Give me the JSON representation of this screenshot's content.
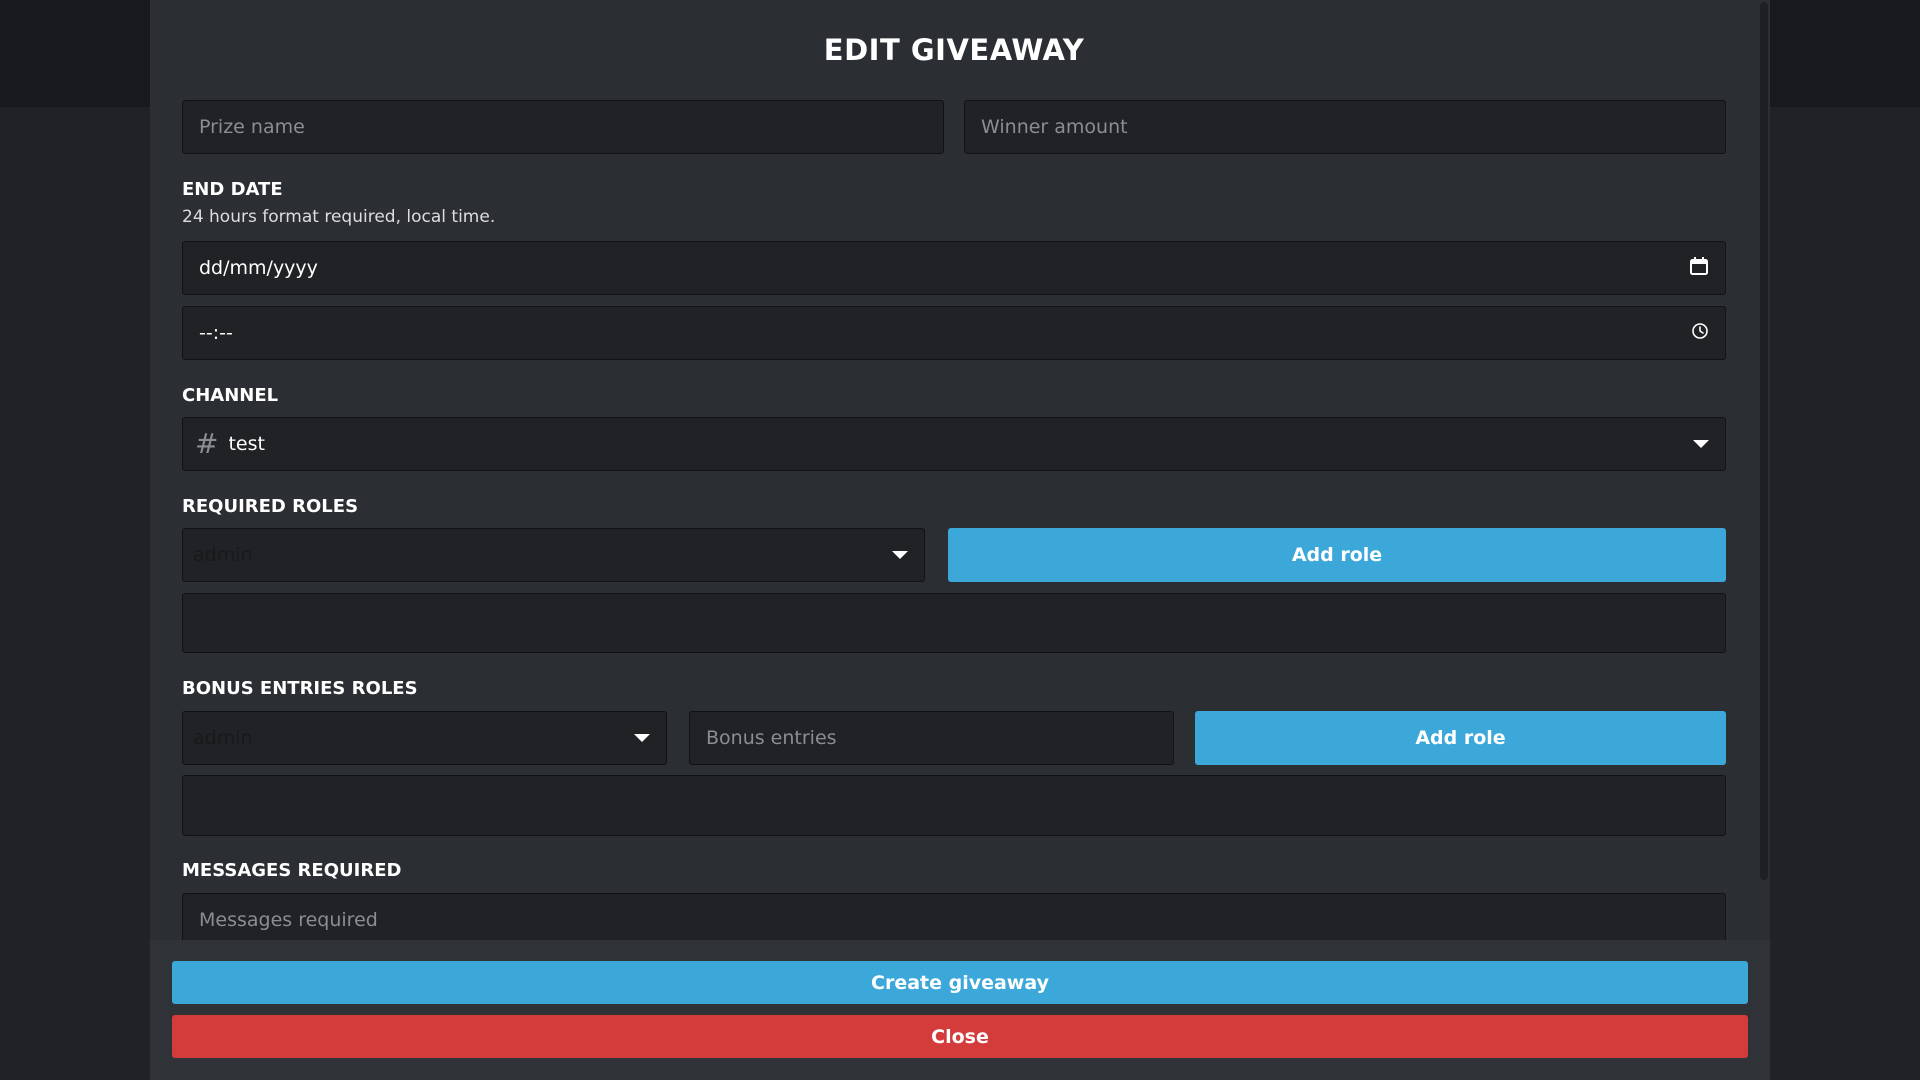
{
  "modal": {
    "title": "EDIT GIVEAWAY"
  },
  "prize": {
    "placeholder": "Prize name"
  },
  "winners": {
    "placeholder": "Winner amount"
  },
  "end_date": {
    "label": "END DATE",
    "hint": "24 hours format required, local time.",
    "date_value": "dd/mm/yyyy",
    "time_value": "--:--",
    "date_icon": "calendar-icon",
    "time_icon": "clock-icon"
  },
  "channel": {
    "label": "CHANNEL",
    "prefix": "#",
    "value": "test"
  },
  "required_roles": {
    "label": "REQUIRED ROLES",
    "selected_role": "admin",
    "add_button": "Add role"
  },
  "bonus_roles": {
    "label": "BONUS ENTRIES ROLES",
    "selected_role": "admin",
    "entries_placeholder": "Bonus entries",
    "add_button": "Add role"
  },
  "messages": {
    "label": "MESSAGES REQUIRED",
    "placeholder": "Messages required"
  },
  "footer": {
    "create_button": "Create giveaway",
    "close_button": "Close"
  },
  "colors": {
    "accent_blue": "#3ca8da",
    "danger_red": "#d43c3c",
    "modal_bg": "#2b2e33",
    "input_bg": "#202225"
  }
}
